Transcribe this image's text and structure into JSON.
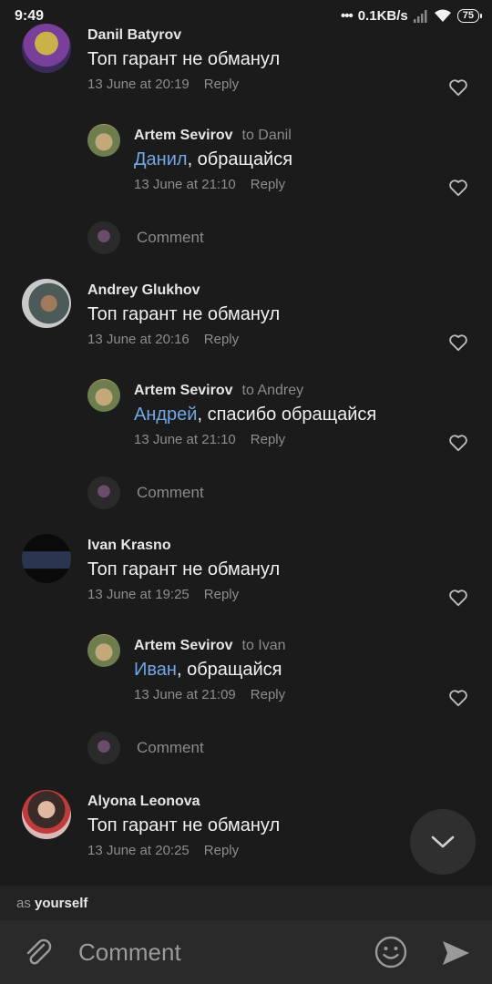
{
  "status": {
    "time": "9:49",
    "net": "0.1KB/s",
    "battery": "75"
  },
  "threads": [
    {
      "name": "Danil Batyrov",
      "text": "Топ гарант не обманул",
      "date": "13 June at 20:19",
      "reply": "Reply",
      "answer": {
        "name": "Artem Sevirov",
        "to": "to Danil",
        "mention": "Данил",
        "rest": ", обращайся",
        "date": "13 June at 21:10",
        "reply": "Reply"
      }
    },
    {
      "name": "Andrey Glukhov",
      "text": "Топ гарант не обманул",
      "date": "13 June at 20:16",
      "reply": "Reply",
      "answer": {
        "name": "Artem Sevirov",
        "to": "to Andrey",
        "mention": "Андрей",
        "rest": ", спасибо обращайся",
        "date": "13 June at 21:10",
        "reply": "Reply"
      }
    },
    {
      "name": "Ivan Krasno",
      "text": "Топ гарант не обманул",
      "date": "13 June at 19:25",
      "reply": "Reply",
      "answer": {
        "name": "Artem Sevirov",
        "to": "to Ivan",
        "mention": "Иван",
        "rest": ", обращайся",
        "date": "13 June at 21:09",
        "reply": "Reply"
      }
    },
    {
      "name": "Alyona Leonova",
      "text": "Топ гарант не обманул",
      "date": "13 June at 20:25",
      "reply": "Reply"
    }
  ],
  "comment_prompt": "Comment",
  "composer": {
    "as_prefix": "as",
    "as_who": "yourself",
    "placeholder": "Comment"
  },
  "colors": {
    "background": "#1b1b1b",
    "mention": "#71a7e6",
    "muted": "#8d8d8d"
  }
}
